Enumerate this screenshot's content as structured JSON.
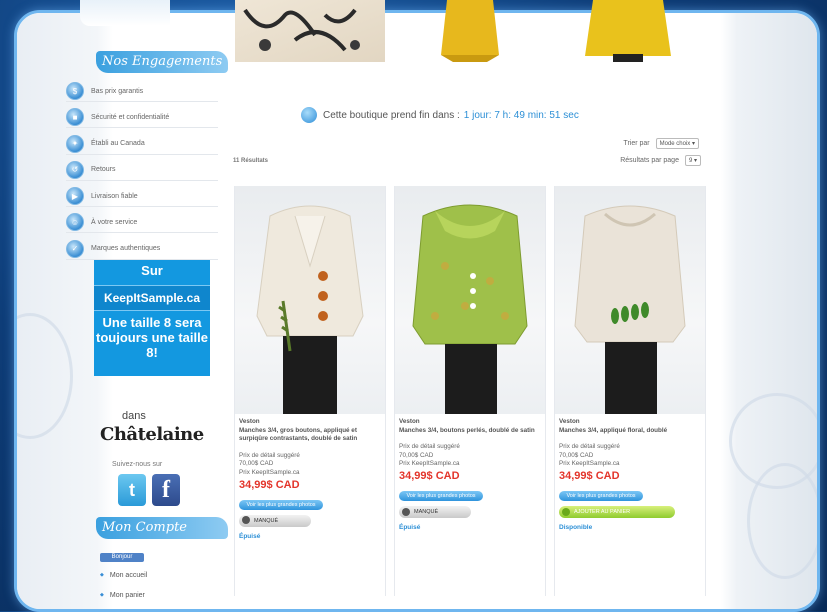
{
  "sidebar": {
    "engagements_title": "Nos Engagements",
    "guarantees": [
      {
        "label": "Bas prix garantis",
        "icon": "tag-icon"
      },
      {
        "label": "Sécurité et confidentialité",
        "icon": "lock-icon"
      },
      {
        "label": "Établi au Canada",
        "icon": "maple-leaf-icon"
      },
      {
        "label": "Retours",
        "icon": "return-icon"
      },
      {
        "label": "Livraison fiable",
        "icon": "truck-icon"
      },
      {
        "label": "À votre service",
        "icon": "support-icon"
      },
      {
        "label": "Marques authentiques",
        "icon": "check-badge-icon"
      }
    ],
    "promo": {
      "line1": "Sur",
      "line2": "KeepItSample.ca",
      "line3": "Une taille 8 sera toujours une taille 8!"
    },
    "press_dans": "dans",
    "press_logo": "Châtelaine",
    "follow_text": "Suivez-nous sur",
    "account_title": "Mon Compte",
    "account_pill": "Bonjour",
    "account_items": [
      "Mon accueil",
      "Mon panier"
    ]
  },
  "countdown": {
    "text": "Cette boutique prend fin dans :",
    "time": "1 jour: 7 h: 49 min: 51 sec"
  },
  "sort": {
    "label": "Trier par",
    "value": "Mode choix"
  },
  "results_count": "11 Résultats",
  "per_page": {
    "label": "Résultats par page",
    "value": "9"
  },
  "products": [
    {
      "type": "Veston",
      "desc": "Manches 3/4, gros boutons, appliqué et surpiqûre contrastants, doublé de satin",
      "retail_label": "Prix de détail suggéré",
      "retail_value": "70,00$ CAD",
      "kis_label": "Prix KeepItSample.ca",
      "price": "34,99$ CAD",
      "more_button": "Voir les plus grandes photos",
      "status_button": "MANQUÉ",
      "availability": "Épuisé"
    },
    {
      "type": "Veston",
      "desc": "Manches 3/4, boutons perlés, doublé de satin",
      "retail_label": "Prix de détail suggéré",
      "retail_value": "70,00$ CAD",
      "kis_label": "Prix KeepItSample.ca",
      "price": "34,99$ CAD",
      "more_button": "Voir les plus grandes photos",
      "status_button": "MANQUÉ",
      "availability": "Épuisé"
    },
    {
      "type": "Veston",
      "desc": "Manches 3/4, appliqué floral, doublé",
      "retail_label": "Prix de détail suggéré",
      "retail_value": "70,00$ CAD",
      "kis_label": "Prix KeepItSample.ca",
      "price": "34,99$ CAD",
      "more_button": "Voir les plus grandes photos",
      "status_button": "AJOUTER AU PANIER",
      "availability": "Disponible"
    }
  ],
  "colors": {
    "accent": "#2c8fd6",
    "price": "#e3352b",
    "frame": "#6fb6ef"
  }
}
